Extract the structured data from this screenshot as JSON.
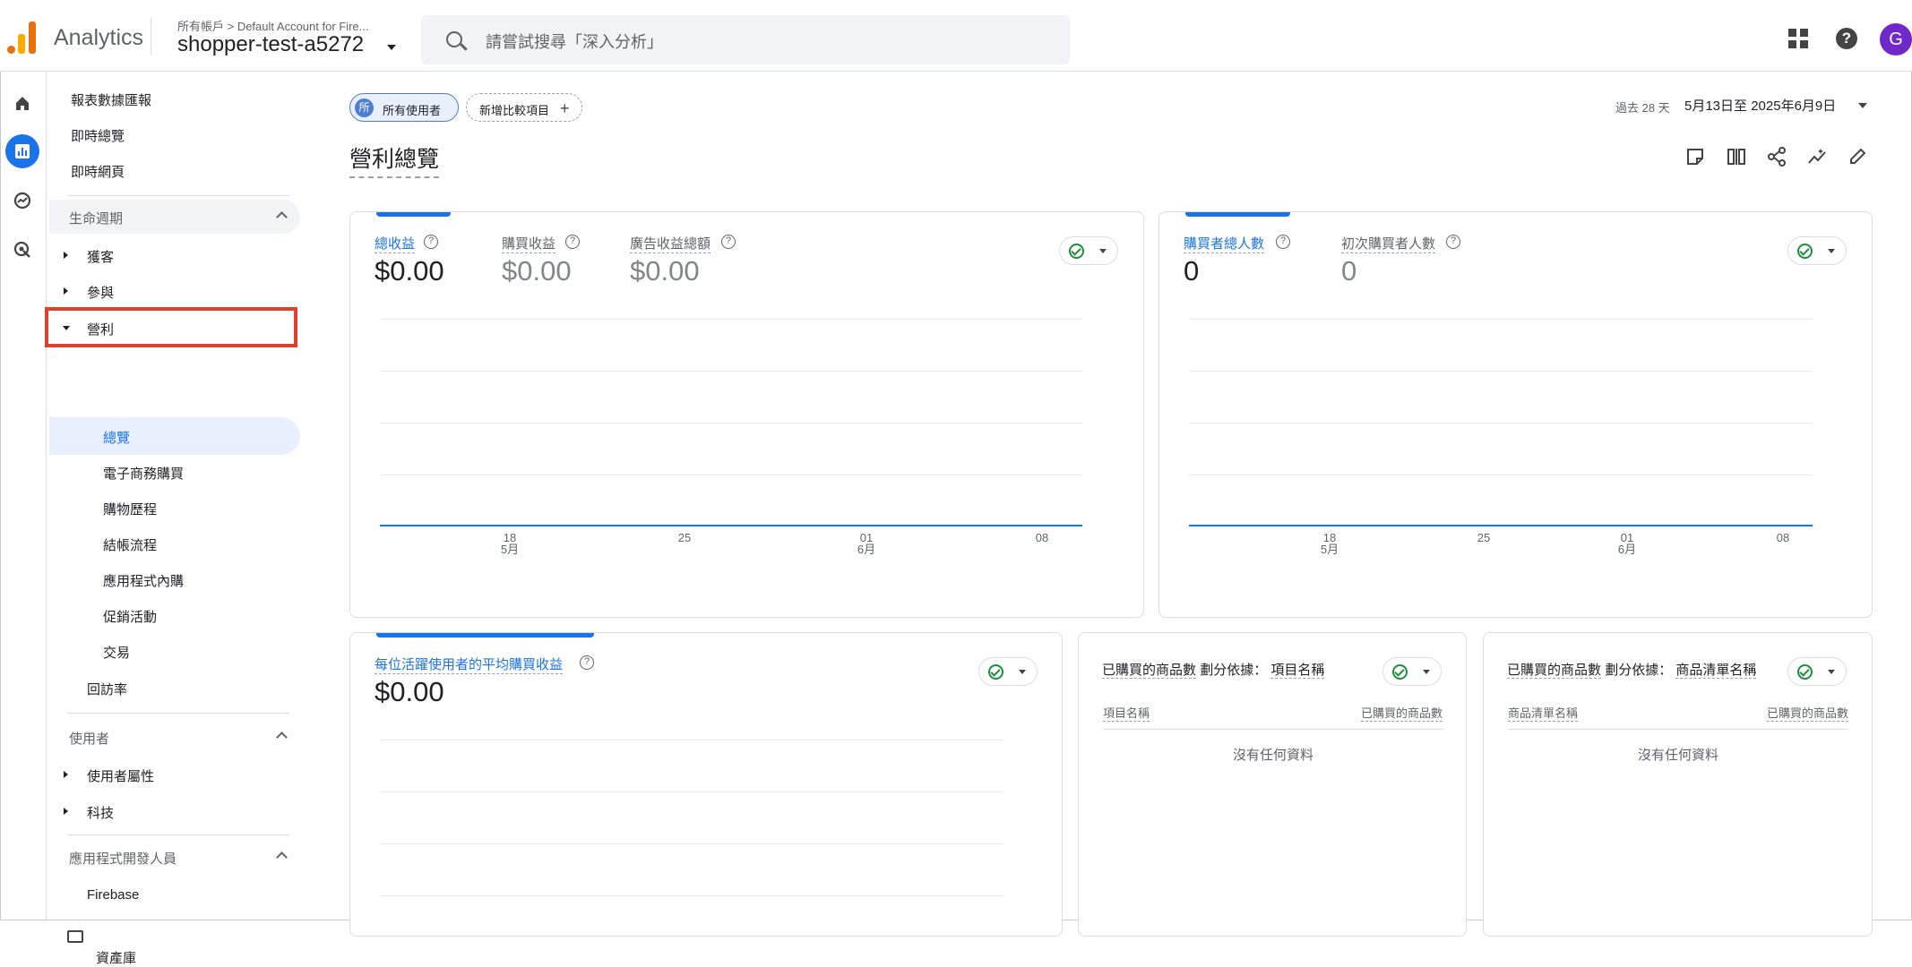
{
  "header": {
    "app_name": "Analytics",
    "breadcrumb": "所有帳戶 > Default Account for Fire...",
    "property": "shopper-test-a5272",
    "search_placeholder": "請嘗試搜尋「深入分析」",
    "avatar_letter": "G"
  },
  "sidebar": {
    "top_items": [
      "報表數據匯報",
      "即時總覽",
      "即時網頁"
    ],
    "lifecycle": {
      "title": "生命週期",
      "items": [
        "獲客",
        "參與",
        "營利"
      ],
      "monetization_sub": [
        "總覽",
        "電子商務購買",
        "購物歷程",
        "結帳流程",
        "應用程式內購",
        "促銷活動",
        "交易"
      ],
      "retention": "回訪率"
    },
    "user": {
      "title": "使用者",
      "items": [
        "使用者屬性",
        "科技"
      ]
    },
    "developer": {
      "title": "應用程式開發人員",
      "items": [
        "Firebase"
      ]
    },
    "library": "資產庫"
  },
  "filters": {
    "segment_badge": "所",
    "segment": "所有使用者",
    "add_comparison": "新增比較項目"
  },
  "date": {
    "prefix": "過去 28 天",
    "range": "5月13日至 2025年6月9日"
  },
  "page_title": "營利總覽",
  "colors": {
    "accent": "#1a73e8",
    "highlight": "#e0412f",
    "ok": "#1e8e3e"
  },
  "cards": {
    "revenue": {
      "metrics": [
        {
          "label": "總收益",
          "value": "$0.00"
        },
        {
          "label": "購買收益",
          "value": "$0.00"
        },
        {
          "label": "廣告收益總額",
          "value": "$0.00"
        }
      ],
      "x_ticks": [
        {
          "d": "18",
          "m": "5月"
        },
        {
          "d": "25",
          "m": ""
        },
        {
          "d": "01",
          "m": "6月"
        },
        {
          "d": "08",
          "m": ""
        }
      ]
    },
    "purchasers": {
      "metrics": [
        {
          "label": "購買者總人數",
          "value": "0"
        },
        {
          "label": "初次購買者人數",
          "value": "0"
        }
      ],
      "x_ticks": [
        {
          "d": "18",
          "m": "5月"
        },
        {
          "d": "25",
          "m": ""
        },
        {
          "d": "01",
          "m": "6月"
        },
        {
          "d": "08",
          "m": ""
        }
      ]
    },
    "arppu": {
      "label": "每位活躍使用者的平均購買收益",
      "value": "$0.00"
    },
    "items_by_name": {
      "title": "已購買的商品數",
      "by": "劃分依據：",
      "dimension": "項目名稱",
      "col1": "項目名稱",
      "col2": "已購買的商品數",
      "empty": "沒有任何資料"
    },
    "items_by_list": {
      "title": "已購買的商品數",
      "by": "劃分依據：",
      "dimension": "商品清單名稱",
      "col1": "商品清單名稱",
      "col2": "已購買的商品數",
      "empty": "沒有任何資料"
    }
  }
}
